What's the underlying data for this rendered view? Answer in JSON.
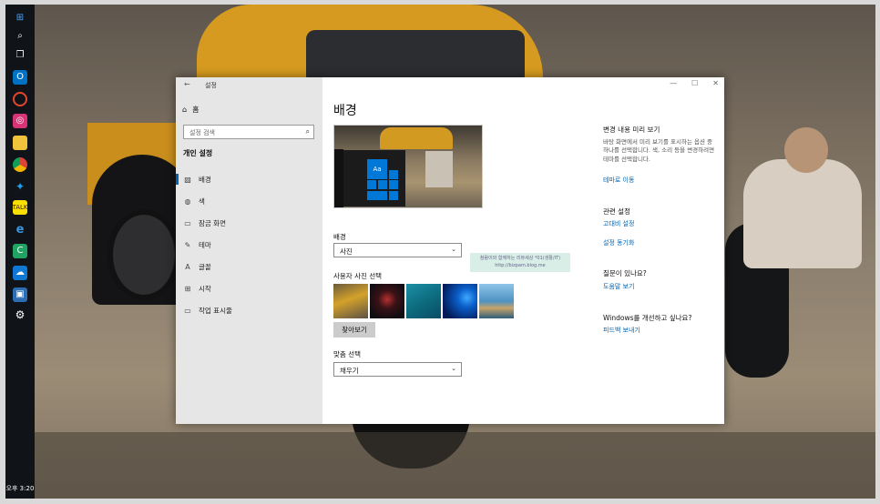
{
  "taskbar": {
    "clock": "오후 3:20",
    "icons": [
      "windows-start-icon",
      "search-icon",
      "task-view-icon",
      "outlook-icon",
      "photo-icon",
      "instagram-icon",
      "file-explorer-icon",
      "chrome-icon",
      "twitter-icon",
      "kakaotalk-icon",
      "edge-icon",
      "camtasia-icon",
      "cloud-icon",
      "store-icon",
      "settings-gear-icon"
    ]
  },
  "window": {
    "title": "설정",
    "controls": [
      "—",
      "☐",
      "✕"
    ]
  },
  "sidebar": {
    "home": "홈",
    "search_placeholder": "설정 검색",
    "section_title": "개인 설정",
    "items": [
      {
        "label": "배경",
        "icon": "image-icon"
      },
      {
        "label": "색",
        "icon": "palette-icon"
      },
      {
        "label": "잠금 화면",
        "icon": "lock-screen-icon"
      },
      {
        "label": "테마",
        "icon": "theme-icon"
      },
      {
        "label": "글꼴",
        "icon": "font-icon"
      },
      {
        "label": "시작",
        "icon": "start-icon"
      },
      {
        "label": "작업 표시줄",
        "icon": "taskbar-icon"
      }
    ],
    "active_index": 0
  },
  "main": {
    "title": "배경",
    "preview_tile_text": "Aa",
    "background_label": "배경",
    "background_value": "사진",
    "choose_photo_label": "사용자 사진 선택",
    "browse_button": "찾아보기",
    "fit_label": "맞춤 선택",
    "fit_value": "채우기",
    "watermark_line1": "참람이와 함께하는 리뷰세상 *01(생활/IT)",
    "watermark_line2": "http://bizpam.blog.me"
  },
  "right_panel": {
    "preview_head": "변경 내용 미리 보기",
    "preview_text": "바탕 화면에서 미리 보기를 표시하는 옵션 중 하나를 선택합니다. 색, 소리 등을 변경하려면 테마를 선택합니다.",
    "theme_link": "테마로 이동",
    "related_head": "관련 설정",
    "high_contrast_link": "고대비 설정",
    "sync_link": "설정 동기화",
    "question_head": "질문이 있나요?",
    "help_link": "도움말 보기",
    "improve_head": "Windows를 개선하고 싶나요?",
    "feedback_link": "피드백 보내기"
  },
  "colors": {
    "accent": "#0078d7",
    "link": "#0063b1",
    "sidebar_bg": "#e6e6e6",
    "taskbar_bg": "#101418"
  }
}
